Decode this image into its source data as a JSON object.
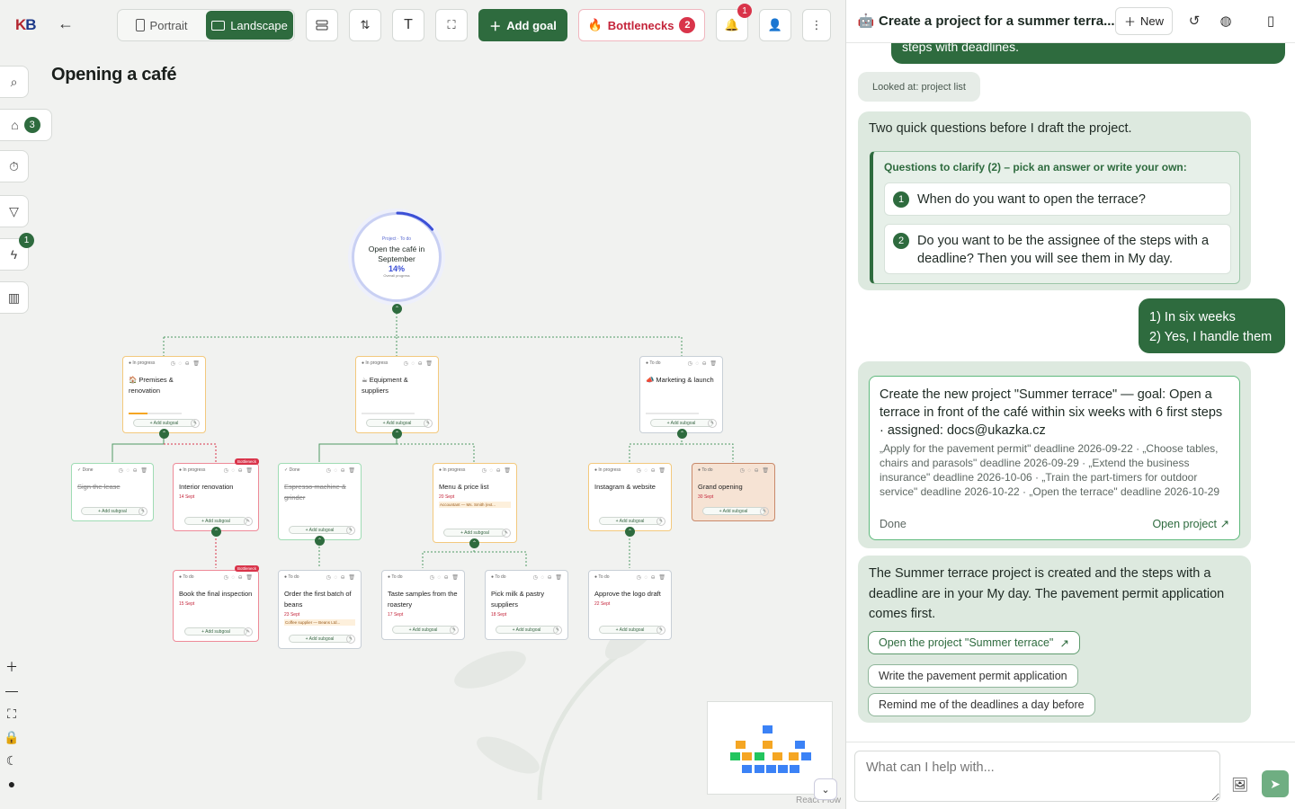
{
  "app": {
    "logo_left": "K",
    "logo_right": "B"
  },
  "toolbar": {
    "portrait": "Portrait",
    "landscape": "Landscape",
    "add_goal": "Add goal",
    "bottlenecks": "Bottlenecks",
    "bottlenecks_count": "2",
    "notif_count": "1"
  },
  "page": {
    "title": "Opening a café"
  },
  "rail": {
    "inbox_count": "3",
    "automation_count": "1"
  },
  "root": {
    "label": "Project · To do",
    "title": "Open the café in September",
    "progress": "14%",
    "progress_value": 14,
    "sub": "Overall progress"
  },
  "cards": [
    {
      "id": "premises",
      "status": "● In progress",
      "name": "🏠 Premises & renovation",
      "kind": "prog",
      "progress": 35,
      "progress_text": "35%"
    },
    {
      "id": "equipment",
      "status": "● In progress",
      "name": "☕ Equipment & suppliers",
      "kind": "prog",
      "progress": 0,
      "progress_text": "0%"
    },
    {
      "id": "marketing",
      "status": "● To do",
      "name": "📣 Marketing & launch",
      "kind": "todo",
      "progress": 0,
      "progress_text": "0%"
    },
    {
      "id": "lease",
      "status": "✓ Done",
      "name": "Sign the lease",
      "kind": "done"
    },
    {
      "id": "interior",
      "status": "● In progress",
      "name": "Interior renovation",
      "kind": "bott",
      "date": "14 Sept",
      "badge": "Bottleneck",
      "progress_text": "0%"
    },
    {
      "id": "espresso",
      "status": "✓ Done",
      "name": "Espresso machine & grinder",
      "kind": "done",
      "progress_text": "0%"
    },
    {
      "id": "menu",
      "status": "● In progress",
      "name": "Menu & price list",
      "kind": "prog",
      "date": "20 Sept",
      "extra": "Accountant — Ms. Smith (ext...",
      "progress_text": "0%"
    },
    {
      "id": "instagram",
      "status": "● In progress",
      "name": "Instagram & website",
      "kind": "prog",
      "progress_text": "0%"
    },
    {
      "id": "grand",
      "status": "● To do",
      "name": "Grand opening",
      "kind": "open",
      "date": "30 Sept"
    },
    {
      "id": "inspection",
      "status": "● To do",
      "name": "Book the final inspection",
      "kind": "bott",
      "date": "15 Sept",
      "badge": "Bottleneck"
    },
    {
      "id": "beans",
      "status": "● To do",
      "name": "Order the first batch of beans",
      "kind": "todo",
      "date": "23 Sept",
      "extra": "Coffee supplier — Beans Ltd..."
    },
    {
      "id": "taste",
      "status": "● To do",
      "name": "Taste samples from the roastery",
      "kind": "todo",
      "date": "17 Sept"
    },
    {
      "id": "milk",
      "status": "● To do",
      "name": "Pick milk & pastry suppliers",
      "kind": "todo",
      "date": "18 Sept"
    },
    {
      "id": "logo",
      "status": "● To do",
      "name": "Approve the logo draft",
      "kind": "todo",
      "date": "22 Sept"
    }
  ],
  "card_labels": {
    "add_subgoal": "+ Add subgoal",
    "avatar": "MR"
  },
  "canvas": {
    "react_flow": "React Flow"
  },
  "chat": {
    "title": "Create a project for a summer terra...",
    "new": "New",
    "prev_tail": "steps with deadlines.",
    "looked_at": "Looked at: project list",
    "questions_intro": "Two quick questions before I draft the project.",
    "questions_head": "Questions to clarify (2) – pick an answer or write your own:",
    "questions": [
      {
        "n": "1",
        "text": "When do you want to open the terrace?"
      },
      {
        "n": "2",
        "text": "Do you want to be the assignee of the steps with a deadline? Then you will see them in My day."
      }
    ],
    "user_answer_1": "1) In six weeks",
    "user_answer_2": "2) Yes, I handle them",
    "proposal_title": "Create the new project \"Summer terrace\" — goal: Open a terrace in front of the café within six weeks with 6 first steps · assigned: docs@ukazka.cz",
    "proposal_detail": "„Apply for the pavement permit\" deadline 2026-09-22 · „Choose tables, chairs and parasols\" deadline 2026-09-29 · „Extend the business insurance\" deadline 2026-10-06 · „Train the part-timers for outdoor service\" deadline 2026-10-22 · „Open the terrace\" deadline 2026-10-29",
    "proposal_status": "Done",
    "proposal_open": "Open project",
    "result": "The Summer terrace project is created and the steps with a deadline are in your My day. The pavement permit application comes first.",
    "suggestions": [
      "Open the project \"Summer terrace\"",
      "Write the pavement permit application",
      "Remind me of the deadlines a day before"
    ],
    "input_placeholder": "What can I help with..."
  },
  "colors": {
    "accent": "#2e6b3e",
    "danger": "#d9344a",
    "in_progress": "#f3c97d",
    "done": "#9fdcb4",
    "todo": "#c8cfd6"
  }
}
